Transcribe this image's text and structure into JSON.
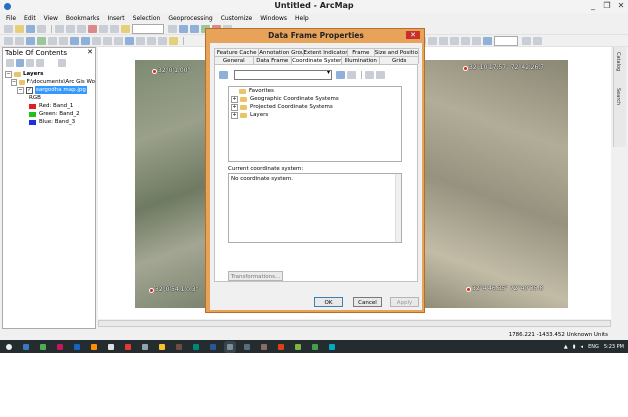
{
  "window": {
    "title": "Untitled - ArcMap",
    "controls": [
      "_",
      "❐",
      "✕"
    ]
  },
  "menu": [
    "File",
    "Edit",
    "View",
    "Bookmarks",
    "Insert",
    "Selection",
    "Geoprocessing",
    "Customize",
    "Windows",
    "Help"
  ],
  "toc": {
    "title": "Table Of Contents",
    "close": "✕",
    "layers_label": "Layers",
    "path": "F:\\documents\\Arc Gis Wo",
    "layer_name": "sargodha map.jpg",
    "rgb_label": "RGB",
    "bands": [
      {
        "label": "Red:   Band_1",
        "color": "#e02020"
      },
      {
        "label": "Green: Band_2",
        "color": "#20c020"
      },
      {
        "label": "Blue:  Band_3",
        "color": "#2030e0"
      }
    ]
  },
  "map": {
    "coords": {
      "top_left": "32°0'1.00\"",
      "top_right": "32°10'17.57\" 72°42'26.7",
      "bottom_left": "32°0'54.1'0.3\"",
      "bottom_right": "32°4'46.35\" 72°40'35.8"
    }
  },
  "right_tabs": [
    "Catalog",
    "Search"
  ],
  "status": {
    "coordinates": "1786.221  -1433.452 Unknown Units"
  },
  "dialog": {
    "title": "Data Frame Properties",
    "close": "✕",
    "tabs_row1": [
      "Feature Cache",
      "Annotation Groups",
      "Extent Indicators",
      "Frame",
      "Size and Position"
    ],
    "tabs_row2": [
      "General",
      "Data Frame",
      "Coordinate System",
      "Illumination",
      "Grids"
    ],
    "active_tab": "Coordinate System",
    "tree": [
      {
        "label": "Favorites",
        "expandable": false
      },
      {
        "label": "Geographic Coordinate Systems",
        "expandable": true
      },
      {
        "label": "Projected Coordinate Systems",
        "expandable": true
      },
      {
        "label": "Layers",
        "expandable": true
      }
    ],
    "current_label": "Current coordinate system:",
    "current_value": "No coordinate system.",
    "transformations_label": "Transformations...",
    "buttons": {
      "ok": "OK",
      "cancel": "Cancel",
      "apply": "Apply"
    }
  },
  "tray": {
    "language": "ENG",
    "time": "5:23 PM"
  },
  "colors": {
    "dialog_border": "#e8a35b",
    "taskbar": "#252c2f",
    "selected_layer": "#3399ff"
  }
}
